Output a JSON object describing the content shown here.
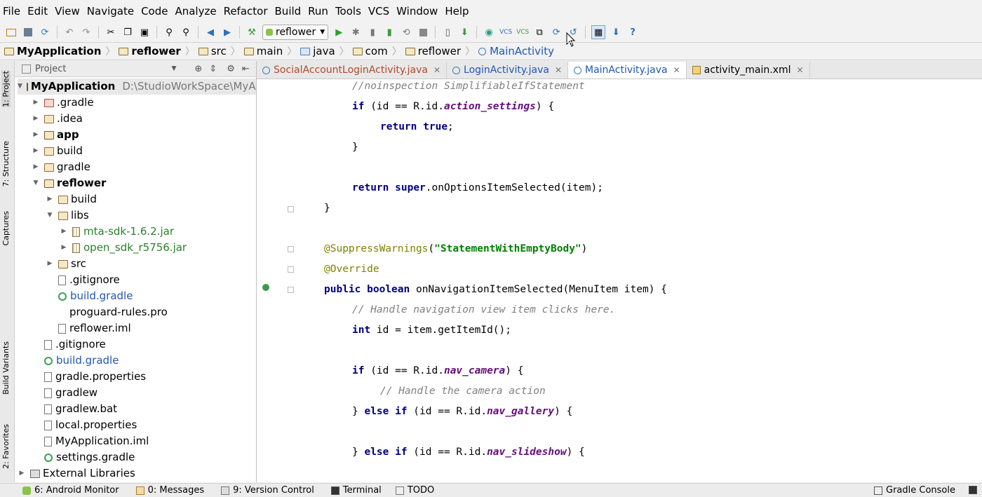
{
  "menu": [
    "File",
    "Edit",
    "View",
    "Navigate",
    "Code",
    "Analyze",
    "Refactor",
    "Build",
    "Run",
    "Tools",
    "VCS",
    "Window",
    "Help"
  ],
  "toolbar": {
    "run_config": "reflower",
    "help_glyph": "?"
  },
  "breadcrumb": [
    "MyApplication",
    "reflower",
    "src",
    "main",
    "java",
    "com",
    "reflower",
    "MainActivity"
  ],
  "side_tabs": {
    "project": "1: Project",
    "structure": "7: Structure",
    "captures": "Captures",
    "build_variants": "Build Variants",
    "favorites": "2: Favorites"
  },
  "project_panel": {
    "title": "Project",
    "rows": [
      {
        "label": "MyApplication",
        "extra": "D:\\StudioWorkSpace\\MyApp"
      },
      {
        "label": ".gradle"
      },
      {
        "label": ".idea"
      },
      {
        "label": "app"
      },
      {
        "label": "build"
      },
      {
        "label": "gradle"
      },
      {
        "label": "reflower"
      },
      {
        "label": "build"
      },
      {
        "label": "libs"
      },
      {
        "label": "mta-sdk-1.6.2.jar"
      },
      {
        "label": "open_sdk_r5756.jar"
      },
      {
        "label": "src"
      },
      {
        "label": ".gitignore"
      },
      {
        "label": "build.gradle"
      },
      {
        "label": "proguard-rules.pro"
      },
      {
        "label": "reflower.iml"
      },
      {
        "label": ".gitignore"
      },
      {
        "label": "build.gradle"
      },
      {
        "label": "gradle.properties"
      },
      {
        "label": "gradlew"
      },
      {
        "label": "gradlew.bat"
      },
      {
        "label": "local.properties"
      },
      {
        "label": "MyApplication.iml"
      },
      {
        "label": "settings.gradle"
      },
      {
        "label": "External Libraries"
      }
    ]
  },
  "editor_tabs": [
    "SocialAccountLoginActivity.java",
    "LoginActivity.java",
    "MainActivity.java",
    "activity_main.xml"
  ],
  "code": {
    "l1": "//noinspection SimplifiableIfStatement",
    "l2_a": "if",
    "l2_b": " (id == R.id.",
    "l2_c": "action_settings",
    "l2_d": ") {",
    "l3_a": "return",
    "l3_b": "true",
    "l3_c": ";",
    "l4": "}",
    "l6_a": "return",
    "l6_b": "super",
    "l6_c": ".onOptionsItemSelected(item);",
    "l7": "}",
    "l9_a": "@SuppressWarnings",
    "l9_b": "(",
    "l9_c": "\"StatementWithEmptyBody\"",
    "l9_d": ")",
    "l10": "@Override",
    "l11_a": "public",
    "l11_b": "boolean",
    "l11_c": " onNavigationItemSelected(MenuItem item) {",
    "l12": "// Handle navigation view item clicks here.",
    "l13_a": "int",
    "l13_b": " id = item.getItemId();",
    "l15_a": "if",
    "l15_b": " (id == R.id.",
    "l15_c": "nav_camera",
    "l15_d": ") {",
    "l16": "// Handle the camera action",
    "l17_a": "} ",
    "l17_b": "else if",
    "l17_c": " (id == R.id.",
    "l17_d": "nav_gallery",
    "l17_e": ") {",
    "l19_a": "} ",
    "l19_b": "else if",
    "l19_c": " (id == R.id.",
    "l19_d": "nav_slideshow",
    "l19_e": ") {"
  },
  "bottom_tabs": [
    "6: Android Monitor",
    "0: Messages",
    "9: Version Control",
    "Terminal",
    "TODO"
  ],
  "bottom_right": "Gradle Console"
}
